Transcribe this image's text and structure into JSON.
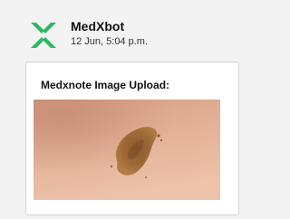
{
  "message": {
    "sender": "MedXbot",
    "timestamp": "12 Jun, 5:04 p.m.",
    "avatar_icon": "medxbot-logo-icon",
    "brand_color": "#2eb860"
  },
  "card": {
    "title": "Medxnote Image Upload:",
    "image_subject": "skin-lesion-photo"
  }
}
